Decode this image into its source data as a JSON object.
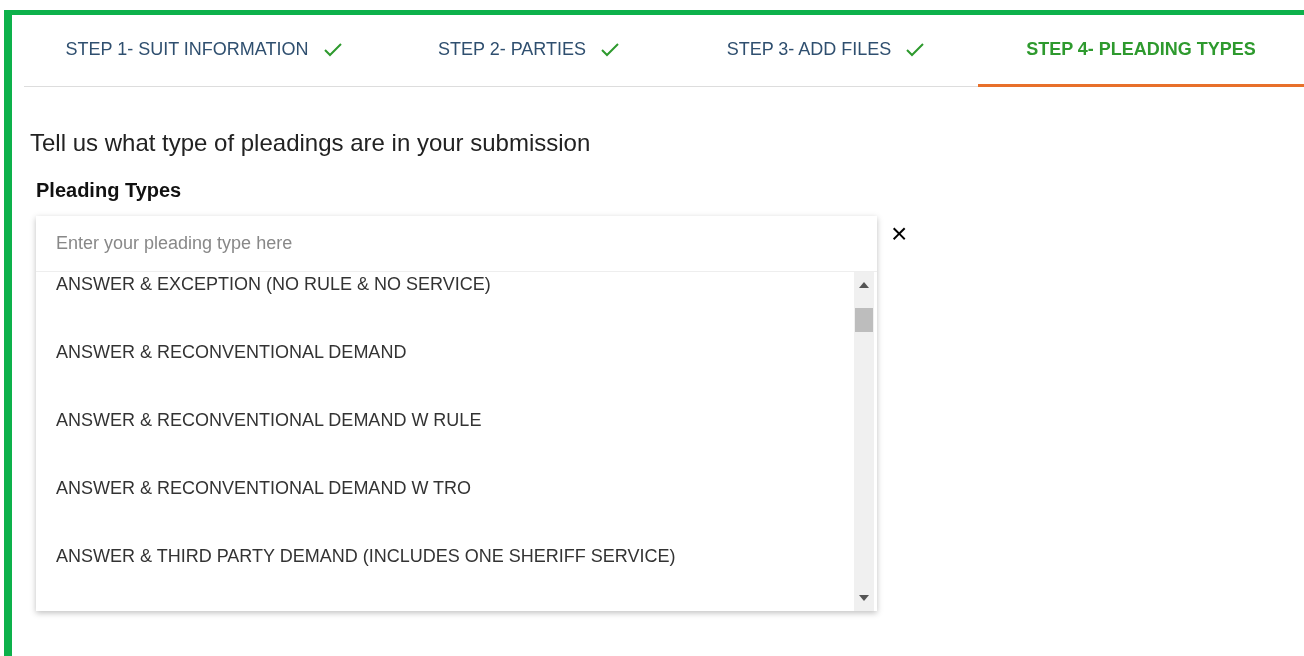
{
  "tabs": [
    {
      "label": "STEP 1- SUIT INFORMATION",
      "completed": true,
      "selected": false
    },
    {
      "label": "STEP 2- PARTIES",
      "completed": true,
      "selected": false
    },
    {
      "label": "STEP 3- ADD FILES",
      "completed": true,
      "selected": false
    },
    {
      "label": "STEP 4- PLEADING TYPES",
      "completed": false,
      "selected": true
    }
  ],
  "heading": "Tell us what type of pleadings are in your submission",
  "field": {
    "label": "Pleading Types",
    "placeholder": "Enter your pleading type here",
    "clear": "×"
  },
  "options": [
    "ANSWER & EXCEPTION (NO RULE & NO SERVICE)",
    "ANSWER & RECONVENTIONAL DEMAND",
    "ANSWER & RECONVENTIONAL DEMAND W RULE",
    "ANSWER & RECONVENTIONAL DEMAND W TRO",
    "ANSWER & THIRD PARTY DEMAND (INCLUDES ONE SHERIFF SERVICE)"
  ]
}
